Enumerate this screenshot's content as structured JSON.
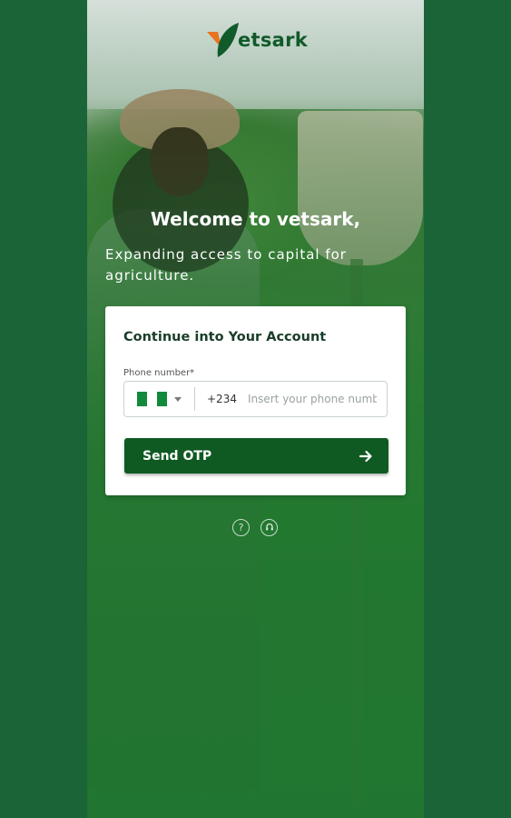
{
  "app": {
    "brand": "etsark",
    "brand_colors": {
      "primary": "#0f5a23",
      "accent_orange": "#e8741e",
      "background": "#1b6437"
    }
  },
  "welcome": {
    "title": "Welcome to vetsark,",
    "tagline": "Expanding access to capital for agriculture."
  },
  "login_card": {
    "title": "Continue into Your Account",
    "phone_label": "Phone number*",
    "country": {
      "flag_icon": "nigeria-flag-icon",
      "dial_code": "+234"
    },
    "phone_placeholder": "Insert your phone number",
    "phone_value": "",
    "send_button_label": "Send OTP"
  },
  "footer_icons": [
    "help-icon",
    "support-icon"
  ]
}
